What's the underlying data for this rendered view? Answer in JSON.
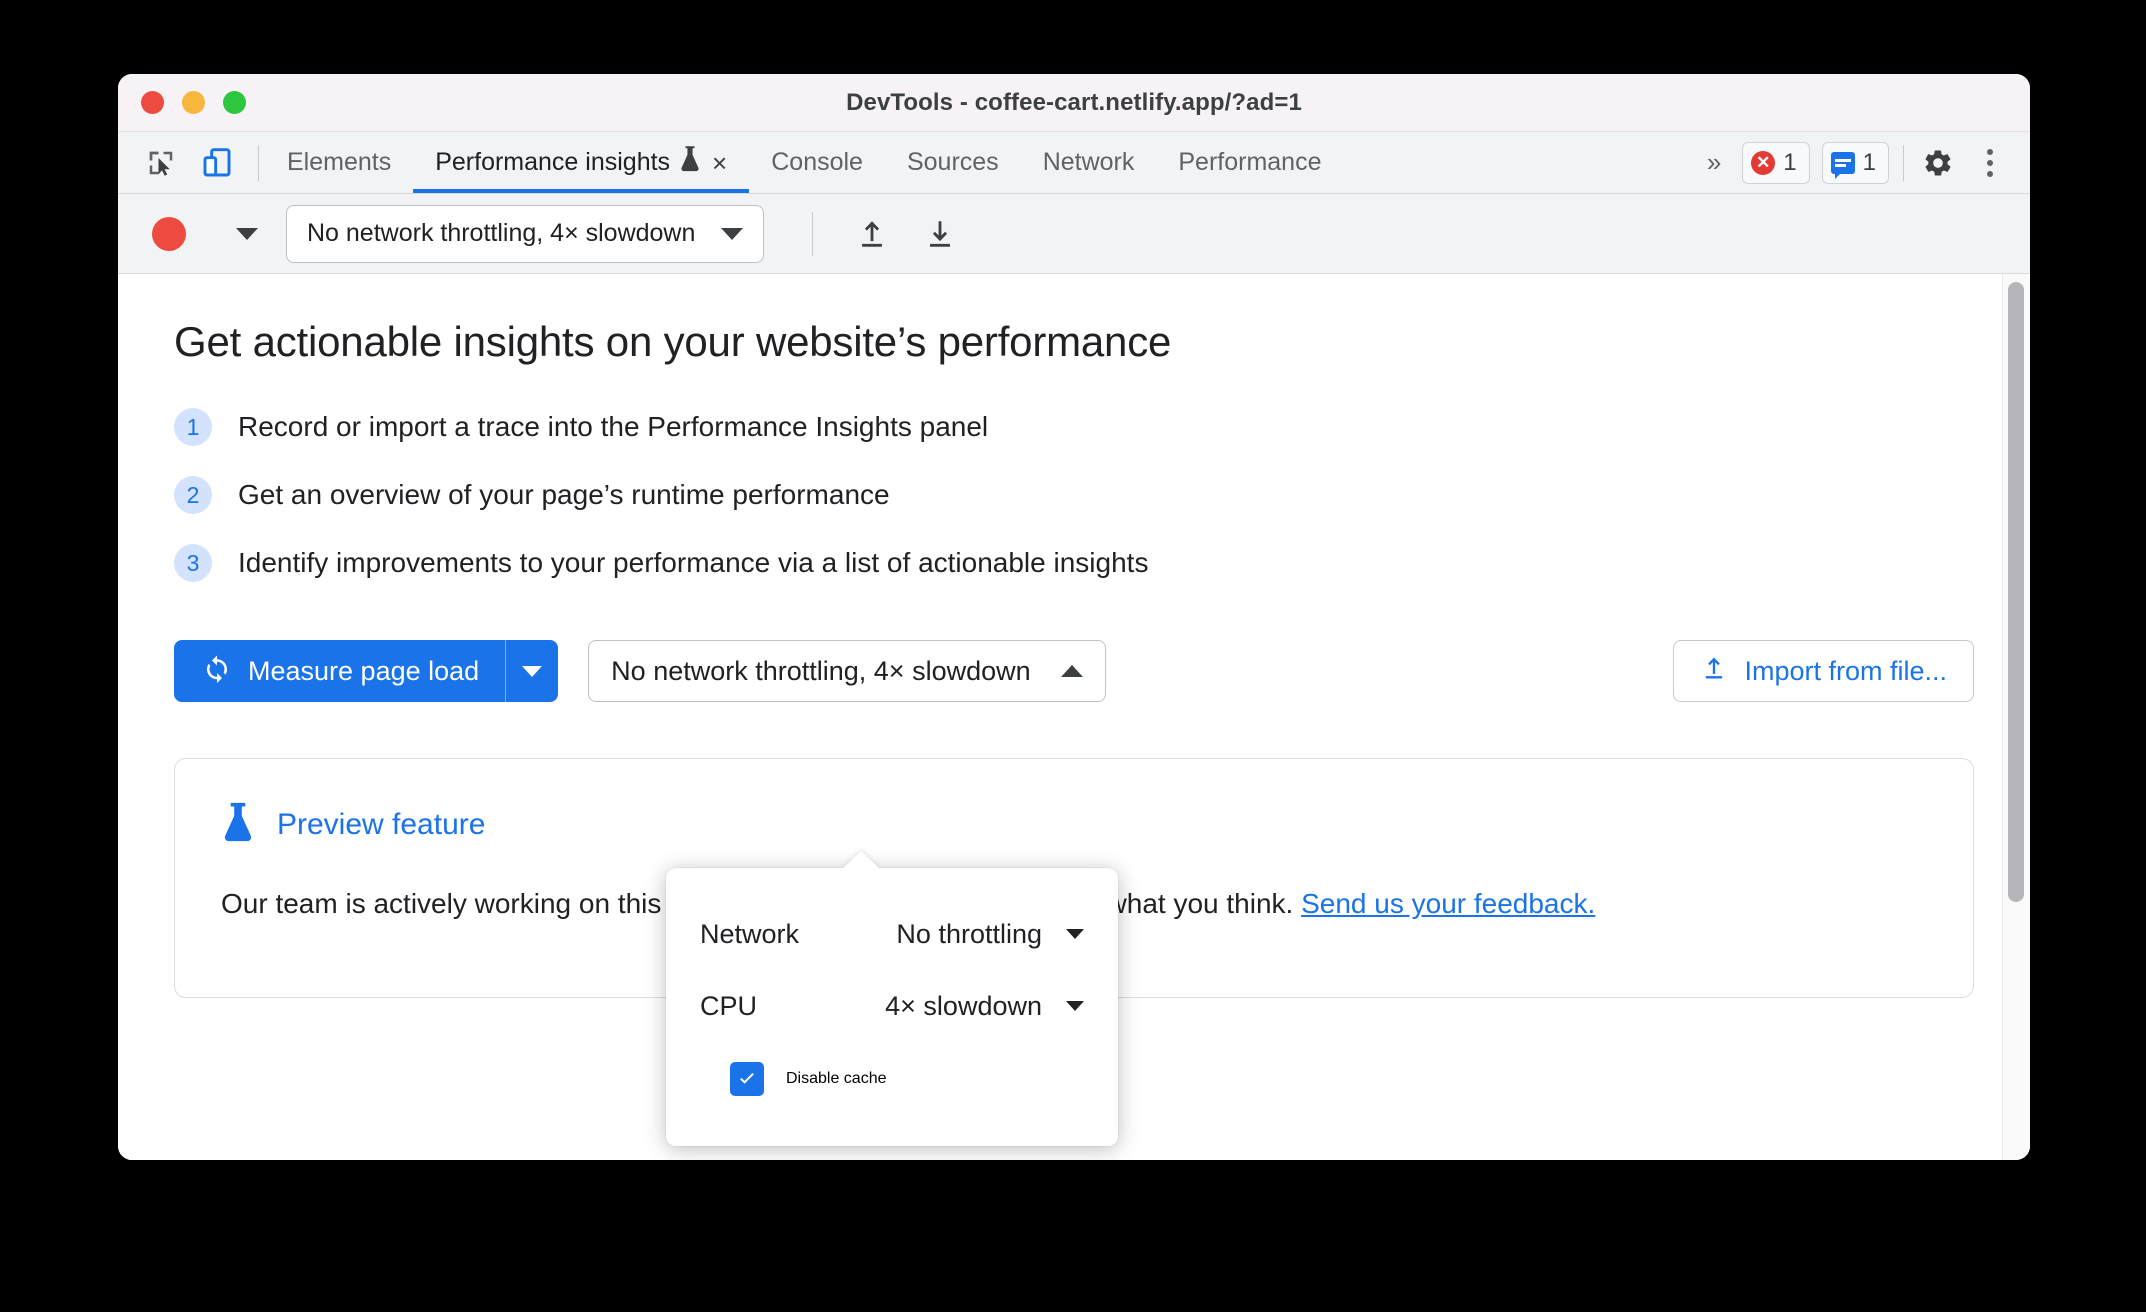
{
  "window": {
    "title": "DevTools - coffee-cart.netlify.app/?ad=1",
    "traffic_lights": [
      "close",
      "minimize",
      "maximize"
    ]
  },
  "tabbar": {
    "icons": [
      {
        "name": "inspect-element-icon",
        "label": "Inspect element"
      },
      {
        "name": "device-toolbar-icon",
        "label": "Toggle device toolbar"
      }
    ],
    "tabs": [
      {
        "label": "Elements",
        "active": false,
        "closable": false
      },
      {
        "label": "Performance insights",
        "active": true,
        "closable": true,
        "experiment": true
      },
      {
        "label": "Console",
        "active": false,
        "closable": false
      },
      {
        "label": "Sources",
        "active": false,
        "closable": false
      },
      {
        "label": "Network",
        "active": false,
        "closable": false
      },
      {
        "label": "Performance",
        "active": false,
        "closable": false
      }
    ],
    "overflow_label": "»",
    "close_label": "×",
    "badges": [
      {
        "name": "error-count",
        "value": "1",
        "color": "#e53935"
      },
      {
        "name": "message-count",
        "value": "1",
        "color": "#1a73e8"
      }
    ],
    "settings_label": "Settings",
    "more_label": "More options"
  },
  "toolbar": {
    "record_label": "Record",
    "record_color": "#ee4b40",
    "record_menu_label": "Record options",
    "throttling_value": "No network throttling, 4× slowdown",
    "upload_label": "Save profile",
    "download_label": "Load profile"
  },
  "main": {
    "headline": "Get actionable insights on your website’s performance",
    "steps": [
      {
        "num": "1",
        "text": "Record or import a trace into the Performance Insights panel"
      },
      {
        "num": "2",
        "text": "Get an overview of your page’s runtime performance"
      },
      {
        "num": "3",
        "text": "Identify improvements to your performance via a list of actionable insights"
      }
    ],
    "measure_button": "Measure page load",
    "measure_dropdown_label": "More measure options",
    "throttling_select": "No network throttling, 4× slowdown",
    "import_button": "Import from file..."
  },
  "popup": {
    "rows": [
      {
        "label": "Network",
        "value": "No throttling"
      },
      {
        "label": "CPU",
        "value": "4× slowdown"
      }
    ],
    "checkbox": {
      "label": "Disable cache",
      "checked": true
    }
  },
  "preview": {
    "title": "Preview feature",
    "body_before_link": "Our team is actively working on this feature and we would love to know what you think. ",
    "link_text": "Send us your feedback."
  },
  "colors": {
    "accent": "#1a73e8",
    "record_red": "#ee4b40",
    "step_badge_bg": "#d3e3fd",
    "tabbar_bg": "#f1f3f4",
    "titlebar_bg": "#f7f2f5"
  }
}
